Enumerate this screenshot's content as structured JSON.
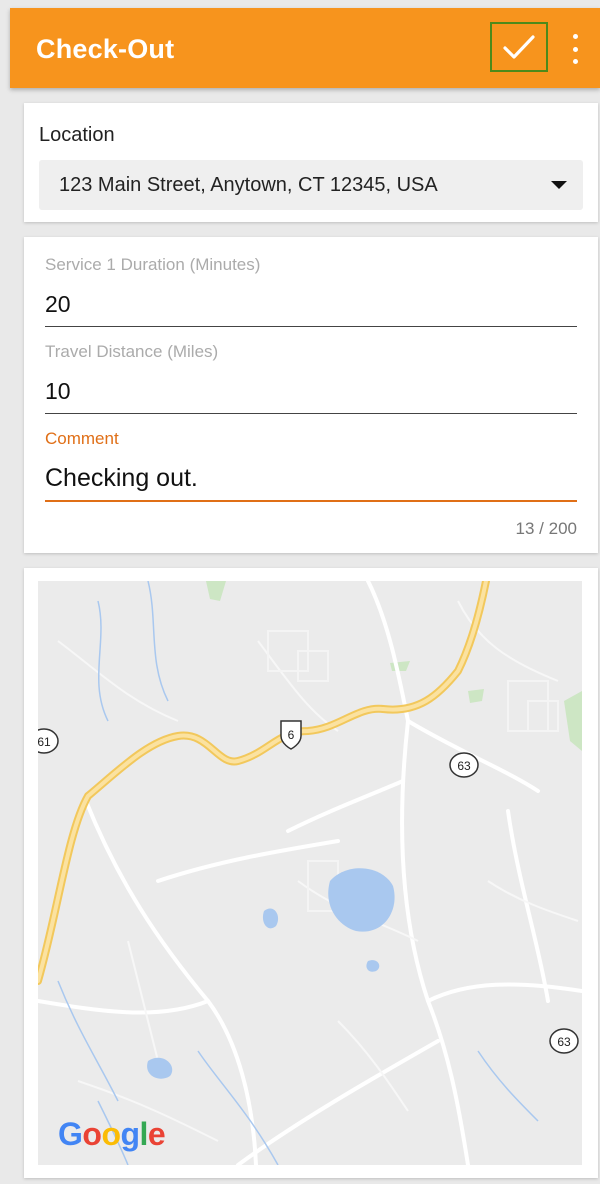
{
  "appbar": {
    "title": "Check-Out",
    "confirm_icon": "check-icon",
    "menu_icon": "more-vert-icon",
    "color": "#f7941d"
  },
  "location": {
    "label": "Location",
    "selected": "123 Main Street, Anytown, CT 12345, USA"
  },
  "form": {
    "service_duration": {
      "label": "Service 1 Duration (Minutes)",
      "value": "20"
    },
    "travel_distance": {
      "label": "Travel Distance (Miles)",
      "value": "10"
    },
    "comment": {
      "label": "Comment",
      "value": "Checking out.",
      "counter": "13 / 200"
    },
    "accent_color": "#e06f17"
  },
  "map": {
    "shields": [
      "61",
      "6",
      "63",
      "63"
    ],
    "logo": "Google"
  }
}
